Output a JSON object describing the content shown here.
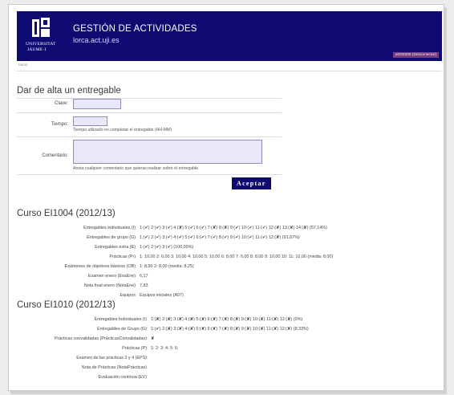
{
  "header": {
    "logo_line1": "UNIVERSITAT",
    "logo_line2": "JAUME·I",
    "title": "GESTIÓN DE ACTIVIDADES",
    "host": "lorca.act.uji.es",
    "user_badge": "al259309 (Desconectar)"
  },
  "breadcrumb": "Inicio",
  "form": {
    "heading": "Dar de alta un entregable",
    "clave_label": "Clave:",
    "tiempo_label": "Tiempo:",
    "tiempo_hint": "Tiempo utilizado en completar el entregable (HH:MM)",
    "comentario_label": "Comentario:",
    "comentario_hint": "Anota cualquier comentario que quieras realizar sobre el entregable",
    "submit_label": "Aceptar"
  },
  "courses": [
    {
      "title": "Curso EI1004 (2012/13)",
      "rows": [
        {
          "label": "Entregables individuales (I)",
          "value": "1:(✔) 2:(✔) 3:(✔) 4:(✘) 5:(✔) 6:(✔) 7:(✘) 8:(✘) 9:(✔) 10:(✔) 11:(✔) 12:(✘) 13:(✘) 14:(✘) (57,14%)"
        },
        {
          "label": "Entregables de grupo (G)",
          "value": "1:(✔) 2:(✔) 3:(✔) 4:(✔) 5:(✔) 6:(✔) 7:(✔) 8:(✔) 9:(✔) 10:(✔) 11:(✔) 12:(✘) (91,67%)"
        },
        {
          "label": "Entregables extra (E)",
          "value": "1:(✔) 2:(✔) 3:(✔) (100,00%)"
        },
        {
          "label": "Prácticas (Pr)",
          "value": "1: 10,00  2: 6,00  3: 10,00  4: 10,00  5: 10,00  6: 8,00  7: 6,00  8: 8,00  9: 10,00  10:   11: 10,00  (media: 8,00)"
        },
        {
          "label": "Exámenes de objetivos básicos (OB)",
          "value": "1: 8,50  2: 8,00  (media: 8,25)"
        },
        {
          "label": "Examen enero (ExaEne)",
          "value": "6,17"
        },
        {
          "label": "Nota final enero (NotaEne)",
          "value": "7,83"
        },
        {
          "label": "Equipos",
          "value": "Equipos iniciales (A07)"
        }
      ]
    },
    {
      "title": "Curso EI1010 (2012/13)",
      "rows": [
        {
          "label": "Entregables Individuales (I)",
          "value": "1:(✘) 2:(✘) 3:(✘) 4:(✘) 5:(✘) 6:(✘) 7:(✘) 8:(✘) 9:(✘) 10:(✘) 11:(✘) 12:(✘) (0%)"
        },
        {
          "label": "Entregables de Grupo (G)",
          "value": "1:(✔) 2:(✘) 3:(✘) 4:(✘) 5:(✘) 6:(✘) 7:(✘) 8:(✘) 9:(✘) 10:(✘) 11:(✘) 12:(✘) (8,33%)"
        },
        {
          "label": "Prácticas convalidadas (PrácticasConvalidadas)",
          "value": "✘"
        },
        {
          "label": "Prácticas (P)",
          "value": "1:  2:  3:  4:  5:  6:"
        },
        {
          "label": "Examen de las prácticas 3 y 4 (EPS)",
          "value": ""
        },
        {
          "label": "Nota de Prácticas (NotaPrácticas)",
          "value": ""
        },
        {
          "label": "Evaluación continua (EV)",
          "value": ""
        }
      ]
    }
  ]
}
